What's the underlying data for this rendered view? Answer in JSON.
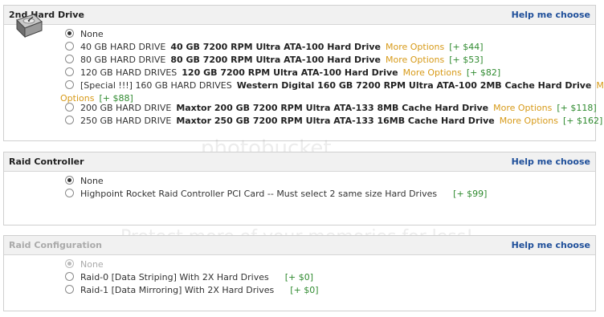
{
  "hard_drive": {
    "title": "2nd Hard Drive",
    "help": "Help me choose",
    "options": [
      {
        "label": "None",
        "desc": "",
        "more": "",
        "price": "",
        "selected": true
      },
      {
        "label": "40 GB HARD DRIVE",
        "desc": "40 GB 7200 RPM Ultra ATA-100 Hard Drive",
        "more": "More Options",
        "price": "[+ $44]"
      },
      {
        "label": "80 GB HARD DRIVE",
        "desc": "80 GB 7200 RPM Ultra ATA-100 Hard Drive",
        "more": "More Options",
        "price": "[+ $53]"
      },
      {
        "label": "120 GB HARD DRIVES",
        "desc": "120 GB 7200 RPM Ultra ATA-100 Hard Drive",
        "more": "More Options",
        "price": "[+ $82]"
      },
      {
        "label": "[Special !!!] 160 GB HARD DRIVES",
        "desc": "Western Digital 160 GB 7200 RPM Ultra ATA-100 2MB Cache Hard Drive",
        "more_a": "More",
        "more_b": "Options",
        "price": "[+ $88]"
      },
      {
        "label": "200 GB HARD DRIVE",
        "desc": "Maxtor 200 GB 7200 RPM Ultra ATA-133 8MB Cache Hard Drive",
        "more": "More Options",
        "price": "[+ $118]"
      },
      {
        "label": "250 GB HARD DRIVE",
        "desc": "Maxtor 250 GB 7200 RPM Ultra ATA-133 16MB Cache Hard Drive",
        "more": "More Options",
        "price": "[+ $162]"
      }
    ]
  },
  "raid_controller": {
    "title": "Raid Controller",
    "help": "Help me choose",
    "options": [
      {
        "label": "None",
        "price": "",
        "selected": true
      },
      {
        "label": "Highpoint Rocket Raid Controller PCI Card -- Must select 2 same size Hard Drives",
        "price": "[+ $99]"
      }
    ]
  },
  "raid_configuration": {
    "title": "Raid Configuration",
    "help": "Help me choose",
    "options": [
      {
        "label": "None",
        "price": "",
        "selected": true,
        "disabled": true
      },
      {
        "label": "Raid-0 [Data Striping] With 2X Hard Drives",
        "price": "[+ $0]"
      },
      {
        "label": "Raid-1 [Data Mirroring] With 2X Hard Drives",
        "price": "[+ $0]"
      }
    ]
  },
  "watermark": {
    "line1": "photobucket",
    "line2": "Protect more of your memories for less!"
  },
  "colors": {
    "link_blue": "#1f4f9a",
    "more_orange": "#d79a18",
    "price_green": "#2f8a2f",
    "header_bg": "#f1f1f1"
  }
}
